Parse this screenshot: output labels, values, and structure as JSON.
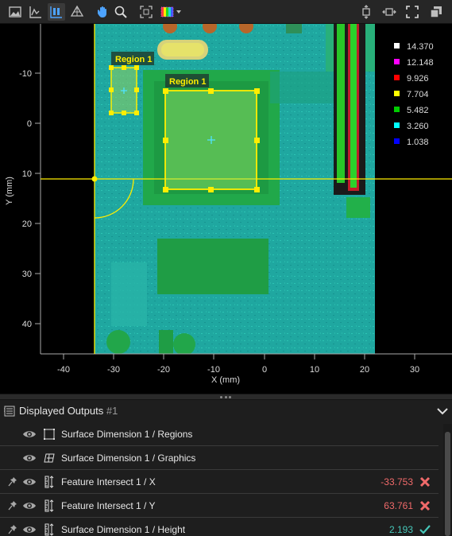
{
  "toolbar": {
    "left_buttons": [
      "image-view-icon",
      "profile-view-icon",
      "surface-view-icon",
      "mesh-3d-icon",
      "pan-hand-icon",
      "zoom-icon",
      "fit-view-icon",
      "colormap-icon"
    ],
    "right_buttons": [
      "fit-height-icon",
      "fit-width-icon",
      "fullscreen-icon",
      "restore-window-icon"
    ]
  },
  "plot": {
    "y_axis_label": "Y (mm)",
    "x_axis_label": "X (mm)",
    "x_ticks": [
      "-40",
      "-30",
      "-20",
      "-10",
      "0",
      "10",
      "20",
      "30"
    ],
    "y_ticks": [
      "-10",
      "0",
      "10",
      "20",
      "30",
      "40"
    ],
    "regions": [
      {
        "label": "Region 1"
      },
      {
        "label": "Region 1"
      }
    ],
    "legend": [
      {
        "value": "14.370",
        "color": "#ffffff"
      },
      {
        "value": "12.148",
        "color": "#ff00ff"
      },
      {
        "value": "9.926",
        "color": "#ff0000"
      },
      {
        "value": "7.704",
        "color": "#ffff00"
      },
      {
        "value": "5.482",
        "color": "#00cc00"
      },
      {
        "value": "3.260",
        "color": "#00ffff"
      },
      {
        "value": "1.038",
        "color": "#0000ff"
      }
    ],
    "accent_color": "#ffee00"
  },
  "outputs": {
    "title": "Displayed Outputs",
    "count": "#1",
    "rows": [
      {
        "label": "Surface Dimension 1 / Regions",
        "pinned": false,
        "icon": "regions-icon",
        "value": "",
        "status": ""
      },
      {
        "label": "Surface Dimension 1 / Graphics",
        "pinned": false,
        "icon": "graphics-icon",
        "value": "",
        "status": ""
      },
      {
        "label": "Feature Intersect 1 / X",
        "pinned": true,
        "icon": "measurement-icon",
        "value": "-33.753",
        "status": "fail"
      },
      {
        "label": "Feature Intersect 1 / Y",
        "pinned": true,
        "icon": "measurement-icon",
        "value": "63.761",
        "status": "fail"
      },
      {
        "label": "Surface Dimension 1 / Height",
        "pinned": true,
        "icon": "measurement-icon",
        "value": "2.193",
        "status": "pass"
      }
    ]
  }
}
